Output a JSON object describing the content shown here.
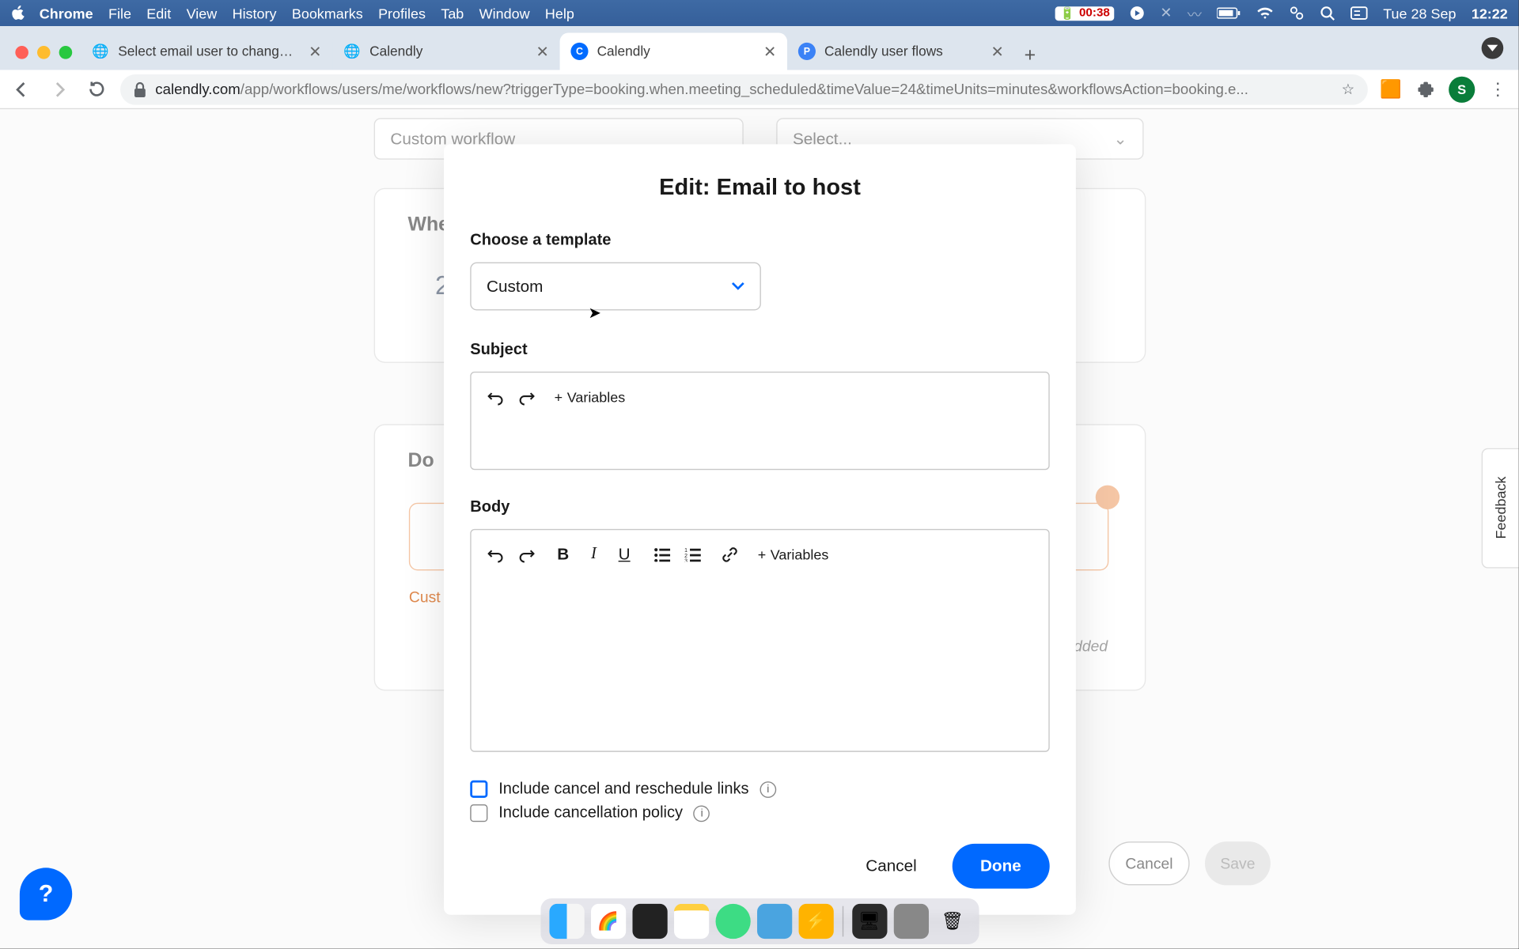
{
  "menubar": {
    "app": "Chrome",
    "items": [
      "File",
      "Edit",
      "View",
      "History",
      "Bookmarks",
      "Profiles",
      "Tab",
      "Window",
      "Help"
    ],
    "battery": "00:38",
    "date": "Tue 28 Sep",
    "time": "12:22"
  },
  "browser": {
    "tabs": [
      {
        "title": "Select email user to change | D",
        "icon": "globe"
      },
      {
        "title": "Calendly",
        "icon": "globe"
      },
      {
        "title": "Calendly",
        "icon": "calendly",
        "active": true
      },
      {
        "title": "Calendly user flows",
        "icon": "pf"
      }
    ],
    "url_host": "calendly.com",
    "url_path": "/app/workflows/users/me/workflows/new?triggerType=booking.when.meeting_scheduled&timeValue=24&timeUnits=minutes&workflowsAction=booking.e...",
    "avatar": "S"
  },
  "background": {
    "workflow_name_placeholder": "Custom workflow",
    "select_placeholder": "Select...",
    "when_heading": "Whe",
    "number_fragment": "2",
    "do_heading": "Do",
    "custom_label": "Cust",
    "added_fragment": "dded",
    "cancel": "Cancel",
    "save": "Save"
  },
  "modal": {
    "title": "Edit: Email to host",
    "template_label": "Choose a template",
    "template_value": "Custom",
    "subject_label": "Subject",
    "body_label": "Body",
    "variables": "Variables",
    "check1": "Include cancel and reschedule links",
    "check2": "Include cancellation policy",
    "cancel": "Cancel",
    "done": "Done"
  },
  "feedback": "Feedback",
  "help": "?"
}
